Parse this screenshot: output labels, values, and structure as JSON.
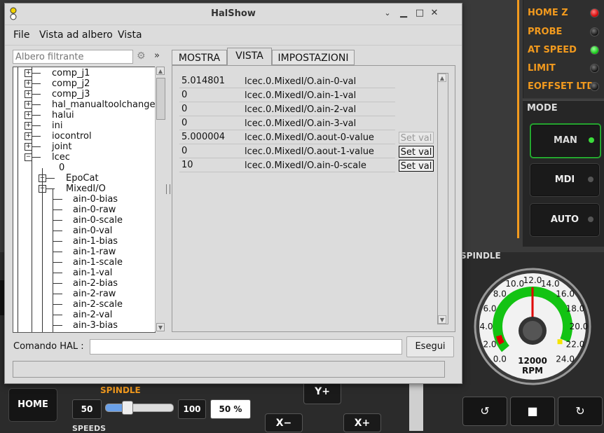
{
  "window": {
    "title": "HalShow",
    "buttons": {
      "minimize": "⨯",
      "restore": "▫"
    }
  },
  "menu": [
    "File",
    "Vista ad albero",
    "Vista"
  ],
  "filter": {
    "placeholder": "Albero filtrante",
    "expand": "»"
  },
  "tree": {
    "items": [
      {
        "label": "comp_j1",
        "level": 1,
        "expanded": false
      },
      {
        "label": "comp_j2",
        "level": 1,
        "expanded": false
      },
      {
        "label": "comp_j3",
        "level": 1,
        "expanded": false
      },
      {
        "label": "hal_manualtoolchange",
        "level": 1,
        "expanded": false
      },
      {
        "label": "halui",
        "level": 1,
        "expanded": false
      },
      {
        "label": "ini",
        "level": 1,
        "expanded": false
      },
      {
        "label": "iocontrol",
        "level": 1,
        "expanded": false
      },
      {
        "label": "joint",
        "level": 1,
        "expanded": false
      },
      {
        "label": "lcec",
        "level": 1,
        "expanded": true
      },
      {
        "label": "0",
        "level": 2,
        "expanded": null
      },
      {
        "label": "EpoCat",
        "level": 3,
        "expanded": false
      },
      {
        "label": "MixedI/O",
        "level": 3,
        "expanded": true
      },
      {
        "label": "ain-0-bias",
        "level": 4,
        "expanded": null
      },
      {
        "label": "ain-0-raw",
        "level": 4,
        "expanded": null
      },
      {
        "label": "ain-0-scale",
        "level": 4,
        "expanded": null
      },
      {
        "label": "ain-0-val",
        "level": 4,
        "expanded": null
      },
      {
        "label": "ain-1-bias",
        "level": 4,
        "expanded": null
      },
      {
        "label": "ain-1-raw",
        "level": 4,
        "expanded": null
      },
      {
        "label": "ain-1-scale",
        "level": 4,
        "expanded": null
      },
      {
        "label": "ain-1-val",
        "level": 4,
        "expanded": null
      },
      {
        "label": "ain-2-bias",
        "level": 4,
        "expanded": null
      },
      {
        "label": "ain-2-raw",
        "level": 4,
        "expanded": null
      },
      {
        "label": "ain-2-scale",
        "level": 4,
        "expanded": null
      },
      {
        "label": "ain-2-val",
        "level": 4,
        "expanded": null
      },
      {
        "label": "ain-3-bias",
        "level": 4,
        "expanded": null
      }
    ]
  },
  "tabs": [
    {
      "label": "MOSTRA",
      "active": false
    },
    {
      "label": "VISTA",
      "active": true
    },
    {
      "label": "IMPOSTAZIONI",
      "active": false
    }
  ],
  "watch": [
    {
      "value": "5.014801",
      "pin": "lcec.0.MixedI/O.ain-0-val",
      "button": null
    },
    {
      "value": "0",
      "pin": "lcec.0.MixedI/O.ain-1-val",
      "button": null
    },
    {
      "value": "0",
      "pin": "lcec.0.MixedI/O.ain-2-val",
      "button": null
    },
    {
      "value": "0",
      "pin": "lcec.0.MixedI/O.ain-3-val",
      "button": null
    },
    {
      "value": "5.000004",
      "pin": "lcec.0.MixedI/O.aout-0-value",
      "button": "Set val",
      "enabled": false
    },
    {
      "value": "0",
      "pin": "lcec.0.MixedI/O.aout-1-value",
      "button": "Set val",
      "enabled": true
    },
    {
      "value": "10",
      "pin": "lcec.0.MixedI/O.ain-0-scale",
      "button": "Set val",
      "enabled": true
    }
  ],
  "command": {
    "label": "Comando HAL :",
    "value": "",
    "execute": "Esegui"
  },
  "bg": {
    "status": [
      {
        "label": "HOME Z",
        "led": "red"
      },
      {
        "label": "PROBE",
        "led": "off"
      },
      {
        "label": "AT SPEED",
        "led": "green"
      },
      {
        "label": "LIMIT",
        "led": "off"
      },
      {
        "label": "EOFFSET LTD",
        "led": "off"
      }
    ],
    "mode_title": "MODE",
    "modes": [
      {
        "label": "MAN",
        "active": true
      },
      {
        "label": "MDI",
        "active": false
      },
      {
        "label": "AUTO",
        "active": false
      }
    ],
    "spindle_title": "SPINDLE",
    "gauge": {
      "ticks": [
        "0.0",
        "2.0",
        "4.0",
        "6.0",
        "8.0",
        "10.0",
        "12.0",
        "14.0",
        "16.0",
        "18.0",
        "20.0",
        "22.0",
        "24.0"
      ],
      "rpm_value": "12000",
      "rpm_unit": "RPM",
      "needle_fraction": 0.5,
      "red": "#e00000",
      "green": "#13c313",
      "yellow": "#f5e400"
    },
    "home": "HOME",
    "spindle_lbl": "SPINDLE",
    "speeds_lbl": "SPEEDS",
    "spindle_min": "50",
    "spindle_max": "100",
    "spindle_pct": "50 %",
    "spindle_slider_fraction": 0.32,
    "accent": "#f29a1e"
  }
}
